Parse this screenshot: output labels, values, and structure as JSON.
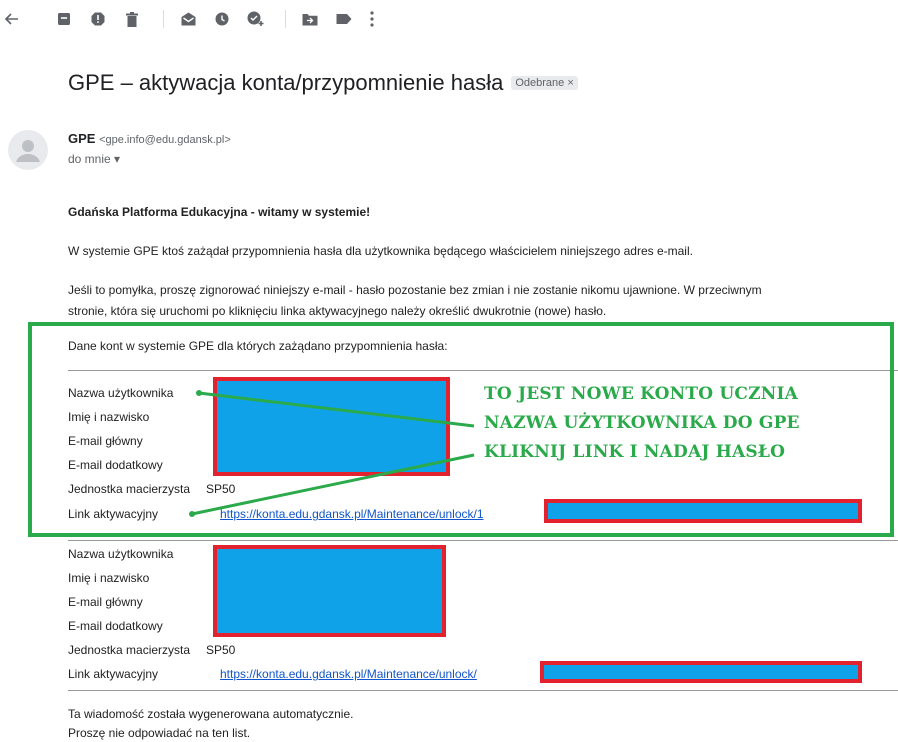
{
  "toolbar": {
    "icons": [
      "back-arrow-icon",
      "archive-icon",
      "report-spam-icon",
      "delete-icon",
      "mark-unread-icon",
      "snooze-icon",
      "add-task-icon",
      "move-to-icon",
      "label-icon",
      "more-vert-icon"
    ]
  },
  "email": {
    "subject": "GPE – aktywacja konta/przypomnienie hasła",
    "label_chip": "Odebrane ×",
    "sender_name": "GPE",
    "sender_address": "<gpe.info@edu.gdansk.pl>",
    "recipient": "do mnie ▾",
    "greeting": "Gdańska Platforma Edukacyjna - witamy w systemie!",
    "para1": "W systemie GPE ktoś zażądał przypomnienia hasła dla użytkownika będącego właścicielem niniejszego adres e-mail.",
    "para2_line1": "Jeśli to pomyłka, proszę zignorować niniejszy e-mail - hasło pozostanie bez zmian i nie zostanie nikomu ujawnione. W przeciwnym",
    "para2_line2": "stronie, która się uruchomi po kliknięciu linka aktywacyjnego należy określić dwukrotnie (nowe) hasło.",
    "accounts_intro": "Dane kont w systemie GPE dla których zażądano przypomnienia hasła:",
    "fields": {
      "username": "Nazwa użytkownika",
      "full_name": "Imię i nazwisko",
      "primary_email": "E-mail główny",
      "secondary_email": "E-mail dodatkowy",
      "unit": "Jednostka macierzysta",
      "activation_link": "Link aktywacyjny"
    },
    "accounts": [
      {
        "unit": "SP50",
        "link": "https://konta.edu.gdansk.pl/Maintenance/unlock/1"
      },
      {
        "unit": "SP50",
        "link": "https://konta.edu.gdansk.pl/Maintenance/unlock/"
      }
    ],
    "footer_line1": "Ta wiadomość została wygenerowana automatycznie.",
    "footer_line2": "Proszę nie odpowiadać na ten list."
  },
  "annotation": {
    "line1": "TO JEST NOWE KONTO UCZNIA",
    "line2": "NAZWA UŻYTKOWNIKA DO GPE",
    "line3": "KLIKNIJ LINK I NADAJ HASŁO"
  },
  "colors": {
    "annotation_green": "#2aaa4a",
    "redaction_blue": "#0fa2e8",
    "redaction_border": "#e2222e",
    "link": "#1155cc"
  }
}
